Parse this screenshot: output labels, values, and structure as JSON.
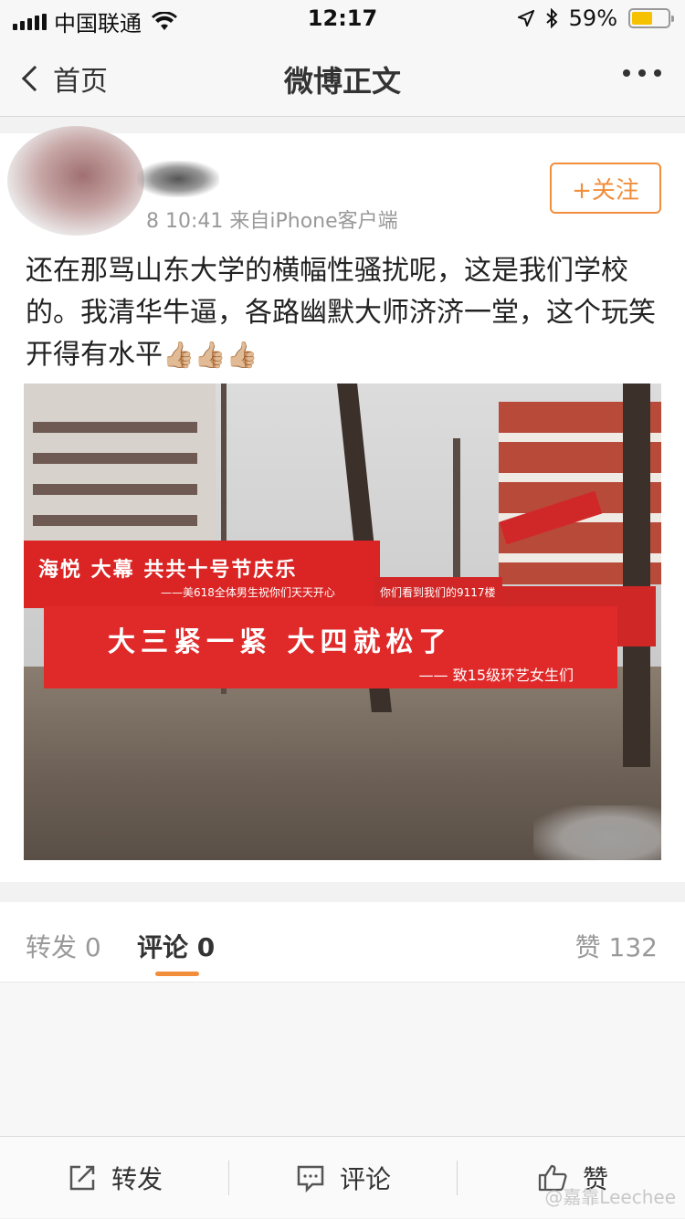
{
  "status_bar": {
    "carrier": "中国联通",
    "time": "12:17",
    "battery_percent": "59%",
    "battery_level": 0.59,
    "battery_color": "#f5c100",
    "icons": [
      "signal-icon",
      "wifi-icon",
      "location-icon",
      "bluetooth-icon",
      "battery-icon"
    ]
  },
  "nav": {
    "back_label": "首页",
    "title": "微博正文",
    "more_icon": "more-icon"
  },
  "post": {
    "meta": "8 10:41  来自iPhone客户端",
    "follow_label": "+关注",
    "text": "还在那骂山东大学的横幅性骚扰呢，这是我们学校的。我清华牛逼，各路幽默大师济济一堂，这个玩笑开得有水平",
    "emoji": "👍🏼👍🏼👍🏼",
    "photo": {
      "banner_main_title": "大三紧一紧   大四就松了",
      "banner_main_sub": "—— 致15级环艺女生们",
      "banner_back_title": "海悦   大幕   共共十号节庆乐",
      "banner_back_sub": "——美618全体男生祝你们天天开心",
      "banner_mid_text": "你们看到我们的9117楼"
    }
  },
  "tabs": {
    "repost": "转发 0",
    "comment": "评论 0",
    "like": "赞 132"
  },
  "bottom_bar": {
    "repost": "转发",
    "comment": "评论",
    "like": "赞",
    "watermark": "@嘉靠Leechee"
  },
  "colors": {
    "accent": "#f18d3b",
    "banner_red": "#e02a2a"
  }
}
